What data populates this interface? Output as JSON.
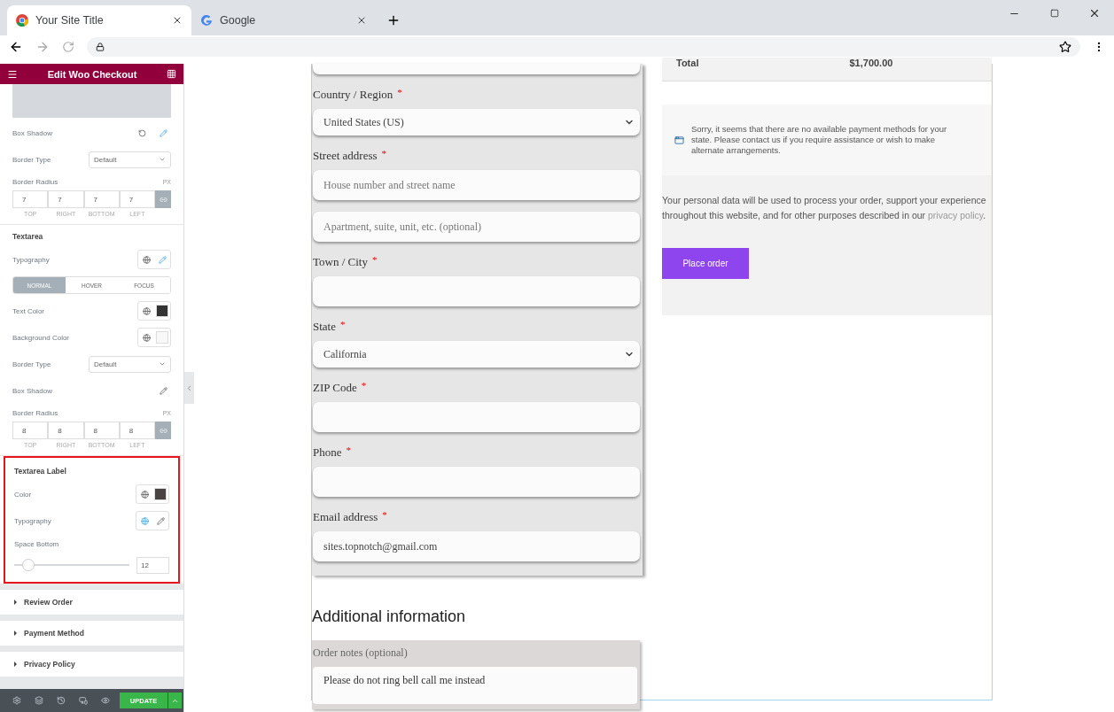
{
  "browser": {
    "tabs": [
      {
        "title": "Your Site Title",
        "selected": true
      },
      {
        "title": "Google",
        "selected": false
      }
    ]
  },
  "panel": {
    "title": "Edit Woo Checkout",
    "groups": [
      {
        "highlighted": false,
        "controls": [
          {
            "kind": "icons",
            "label": "Box Shadow",
            "actions": [
              {
                "kind": "reset",
                "active": false
              },
              {
                "kind": "edit",
                "active": true
              }
            ]
          },
          {
            "kind": "select",
            "label": "Border Type",
            "value": "Default"
          },
          {
            "kind": "dimensions",
            "label": "Border Radius",
            "unit": "PX",
            "values": [
              "7",
              "7",
              "7",
              "7"
            ],
            "sides": [
              "TOP",
              "RIGHT",
              "BOTTOM",
              "LEFT"
            ]
          }
        ]
      },
      {
        "heading": "Textarea",
        "highlighted": false,
        "controls": [
          {
            "kind": "icons",
            "label": "Typography",
            "actions": [
              {
                "kind": "globe",
                "active": false
              },
              {
                "kind": "edit",
                "active": true
              }
            ]
          },
          {
            "kind": "states",
            "tabs": [
              {
                "label": "NORMAL",
                "selected": true
              },
              {
                "label": "HOVER",
                "selected": false
              },
              {
                "label": "FOCUS",
                "selected": false
              }
            ]
          },
          {
            "kind": "color",
            "label": "Text Color",
            "color": "#333333"
          },
          {
            "kind": "color",
            "label": "Background Color",
            "color": "#f8f8f8"
          },
          {
            "kind": "select",
            "label": "Border Type",
            "value": "Default"
          },
          {
            "kind": "icons",
            "label": "Box Shadow",
            "actions": [
              {
                "kind": "edit",
                "active": false
              }
            ]
          },
          {
            "kind": "dimensions",
            "label": "Border Radius",
            "unit": "PX",
            "values": [
              "8",
              "8",
              "8",
              "8"
            ],
            "sides": [
              "TOP",
              "RIGHT",
              "BOTTOM",
              "LEFT"
            ]
          }
        ]
      },
      {
        "heading": "Textarea Label",
        "highlighted": true,
        "controls": [
          {
            "kind": "color",
            "label": "Color",
            "color": "#4a4344"
          },
          {
            "kind": "icons",
            "label": "Typography",
            "actions": [
              {
                "kind": "globe",
                "active": true
              },
              {
                "kind": "edit",
                "active": false
              }
            ]
          },
          {
            "kind": "slider",
            "label": "Space Bottom",
            "level": 0.12,
            "value": "12"
          }
        ]
      }
    ],
    "sections": [
      "Review Order",
      "Payment Method",
      "Privacy Policy"
    ],
    "update_button": "UPDATE"
  },
  "checkout": {
    "fields": [
      {
        "kind": "select",
        "label": "Country / Region",
        "required_mark": "*",
        "value": "United States (US)"
      },
      {
        "kind": "input",
        "label": "Street address",
        "required_mark": "*",
        "placeholder": "House number and street name"
      },
      {
        "kind": "input",
        "placeholder": "Apartment, suite, unit, etc. (optional)"
      },
      {
        "kind": "input",
        "label": "Town / City",
        "required_mark": "*"
      },
      {
        "kind": "select",
        "label": "State",
        "required_mark": "*",
        "value": "California"
      },
      {
        "kind": "input",
        "label": "ZIP Code",
        "required_mark": "*"
      },
      {
        "kind": "input",
        "label": "Phone",
        "required_mark": "*"
      },
      {
        "kind": "input",
        "label": "Email address",
        "required_mark": "*",
        "value": "sites.topnotch@gmail.com"
      }
    ],
    "additional_heading": "Additional information",
    "notes": {
      "label": "Order notes (optional)",
      "value": "Please do not ring bell call me instead"
    },
    "total": {
      "label": "Total",
      "amount": "$1,700.00"
    },
    "payment_notice": "Sorry, it seems that there are no available payment methods for your state. Please contact us if you require assistance or wish to make alternate arrangements.",
    "privacy_text": "Your personal data will be used to process your order, support your experience throughout this website, and for other purposes described in our",
    "privacy_link": "privacy policy",
    "privacy_end": ".",
    "place_order": "Place order"
  }
}
